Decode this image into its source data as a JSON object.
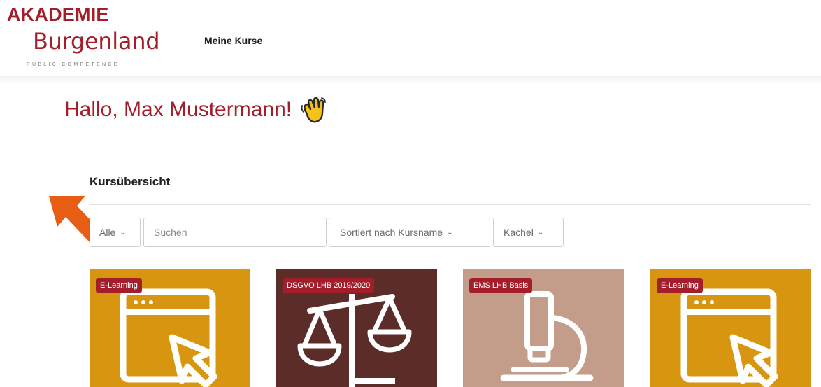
{
  "brand": {
    "name_line1": "AKADEMIE",
    "name_line2": "Burgenland",
    "tagline": "PUBLIC COMPETENCE",
    "color": "#a31d2b"
  },
  "nav": {
    "my_courses": "Meine Kurse"
  },
  "greeting": {
    "text": "Hallo, Max Mustermann!",
    "icon": "waving-hand-icon"
  },
  "overview": {
    "title": "Kursübersicht",
    "filter_value": "Alle",
    "search_placeholder": "Suchen",
    "sort_value": "Sortiert nach Kursname",
    "view_value": "Kachel"
  },
  "courses": [
    {
      "badge": "E-Learning",
      "icon": "browser-cursor-icon",
      "color": "#d8950f"
    },
    {
      "badge": "DSGVO LHB 2019/2020",
      "icon": "scales-icon",
      "color": "#5b2c28"
    },
    {
      "badge": "EMS LHB Basis",
      "icon": "microscope-icon",
      "color": "#c39c8a"
    },
    {
      "badge": "E-Learning",
      "icon": "browser-cursor-icon",
      "color": "#d8950f"
    }
  ]
}
